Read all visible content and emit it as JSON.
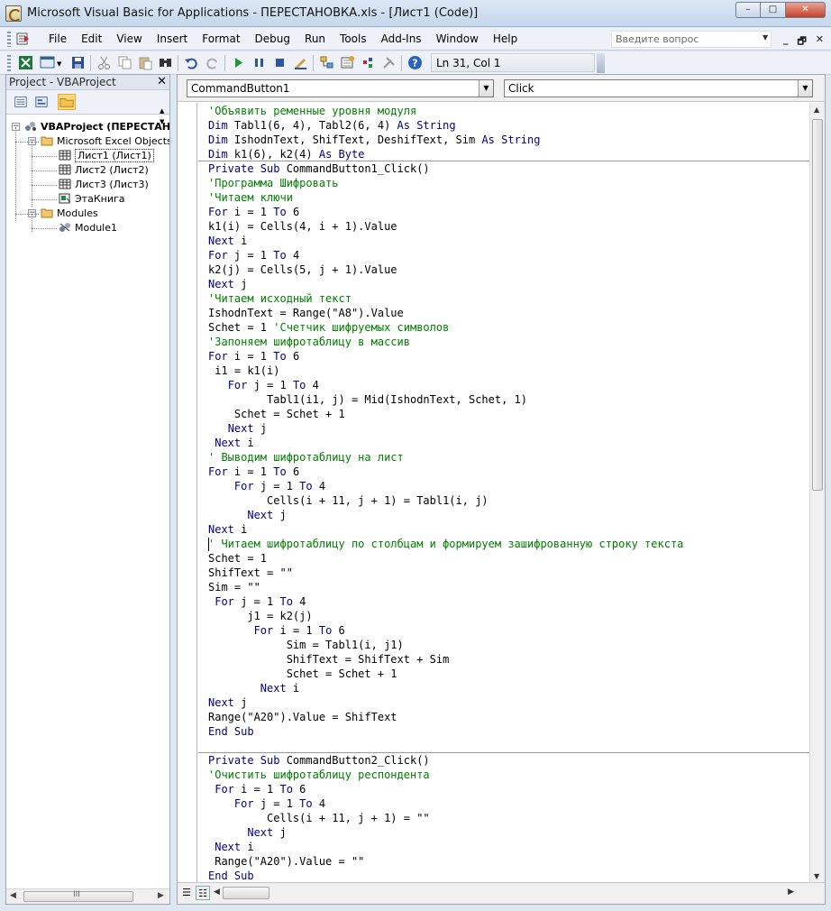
{
  "window": {
    "title": "Microsoft Visual Basic for Applications - ПЕРЕСТАНОВКА.xls - [Лист1 (Code)]",
    "minimize": "–",
    "maximize": "□",
    "close": "✕"
  },
  "menubar": {
    "items": [
      "File",
      "Edit",
      "View",
      "Insert",
      "Format",
      "Debug",
      "Run",
      "Tools",
      "Add-Ins",
      "Window",
      "Help"
    ],
    "question_placeholder": "Введите вопрос",
    "mdi": [
      "_",
      "🗗",
      "✕"
    ]
  },
  "toolbar": {
    "position": "Ln 31, Col 1"
  },
  "project": {
    "title": "Project - VBAProject",
    "close": "✕",
    "tree": [
      {
        "label": "VBAProject (ПЕРЕСТАНО",
        "level": 0,
        "icon": "vbaproject-icon",
        "expander": "−",
        "bold": true
      },
      {
        "label": "Microsoft Excel Objects",
        "level": 1,
        "icon": "folder-icon",
        "expander": "−"
      },
      {
        "label": "Лист1 (Лист1)",
        "level": 2,
        "icon": "worksheet-icon",
        "selected": true
      },
      {
        "label": "Лист2 (Лист2)",
        "level": 2,
        "icon": "worksheet-icon"
      },
      {
        "label": "Лист3 (Лист3)",
        "level": 2,
        "icon": "worksheet-icon"
      },
      {
        "label": "ЭтаКнига",
        "level": 2,
        "icon": "workbook-icon"
      },
      {
        "label": "Modules",
        "level": 1,
        "icon": "folder-icon",
        "expander": "−"
      },
      {
        "label": "Module1",
        "level": 2,
        "icon": "module-icon"
      }
    ],
    "scroll_label": "III"
  },
  "code": {
    "object_combo": "CommandButton1",
    "procedure_combo": "Click",
    "lines": [
      {
        "t": "'Объявить ременные уровня модуля",
        "c": "cm"
      },
      {
        "t": "Dim Tabl1(6, 4), Tabl2(6, 4) As String",
        "c": "dim1"
      },
      {
        "t": "Dim IshodnText, ShifText, DeshifText, Sim As String",
        "c": "dim2"
      },
      {
        "t": "Dim k1(6), k2(4) As Byte",
        "c": "dim3"
      },
      {
        "t": "Private Sub CommandButton1_Click()",
        "c": "sub"
      },
      {
        "t": "'Программа Шифровать",
        "c": "cm"
      },
      {
        "t": "'Читаем ключи",
        "c": "cm"
      },
      {
        "t": "For i = 1 To 6",
        "c": "for"
      },
      {
        "t": "k1(i) = Cells(4, i + 1).Value",
        "c": ""
      },
      {
        "t": "Next i",
        "c": "next"
      },
      {
        "t": "For j = 1 To 4",
        "c": "for"
      },
      {
        "t": "k2(j) = Cells(5, j + 1).Value",
        "c": ""
      },
      {
        "t": "Next j",
        "c": "next"
      },
      {
        "t": "'Читаем исходный текст",
        "c": "cm"
      },
      {
        "t": "IshodnText = Range(\"A8\").Value",
        "c": ""
      },
      {
        "t": "Schet = 1 'Счетчик шифруемых символов",
        "c": "trail"
      },
      {
        "t": "'Запоняем шифротаблицу в массив",
        "c": "cm"
      },
      {
        "t": "For i = 1 To 6",
        "c": "for"
      },
      {
        "t": " i1 = k1(i)",
        "c": ""
      },
      {
        "t": "   For j = 1 To 4",
        "c": "for"
      },
      {
        "t": "         Tabl1(i1, j) = Mid(IshodnText, Schet, 1)",
        "c": ""
      },
      {
        "t": "    Schet = Schet + 1",
        "c": ""
      },
      {
        "t": "   Next j",
        "c": "next"
      },
      {
        "t": " Next i",
        "c": "next"
      },
      {
        "t": "' Выводим шифротаблицу на лист",
        "c": "cm"
      },
      {
        "t": "For i = 1 To 6",
        "c": "for"
      },
      {
        "t": "    For j = 1 To 4",
        "c": "for"
      },
      {
        "t": "         Cells(i + 11, j + 1) = Tabl1(i, j)",
        "c": ""
      },
      {
        "t": "      Next j",
        "c": "next"
      },
      {
        "t": "Next i",
        "c": "next"
      },
      {
        "t": "' Читаем шифротаблицу по столбцам и формируем зашифрованную строку текста",
        "c": "cm"
      },
      {
        "t": "Schet = 1",
        "c": ""
      },
      {
        "t": "ShifText = \"\"",
        "c": ""
      },
      {
        "t": "Sim = \"\"",
        "c": ""
      },
      {
        "t": " For j = 1 To 4",
        "c": "for"
      },
      {
        "t": "      j1 = k2(j)",
        "c": ""
      },
      {
        "t": "       For i = 1 To 6",
        "c": "for"
      },
      {
        "t": "            Sim = Tabl1(i, j1)",
        "c": ""
      },
      {
        "t": "            ShifText = ShifText + Sim",
        "c": ""
      },
      {
        "t": "            Schet = Schet + 1",
        "c": ""
      },
      {
        "t": "        Next i",
        "c": "next"
      },
      {
        "t": "Next j",
        "c": "next"
      },
      {
        "t": "Range(\"A20\").Value = ShifText",
        "c": ""
      },
      {
        "t": "End Sub",
        "c": "kwline"
      },
      {
        "t": "",
        "c": ""
      },
      {
        "t": "Private Sub CommandButton2_Click()",
        "c": "sub"
      },
      {
        "t": "'Очистить шифротаблицу респондента",
        "c": "cm"
      },
      {
        "t": " For i = 1 To 6",
        "c": "for"
      },
      {
        "t": "    For j = 1 To 4",
        "c": "for"
      },
      {
        "t": "         Cells(i + 11, j + 1) = \"\"",
        "c": ""
      },
      {
        "t": "      Next j",
        "c": "next"
      },
      {
        "t": " Next i",
        "c": "next"
      },
      {
        "t": " Range(\"A20\").Value = \"\"",
        "c": ""
      },
      {
        "t": "End Sub",
        "c": "kwline"
      }
    ]
  }
}
